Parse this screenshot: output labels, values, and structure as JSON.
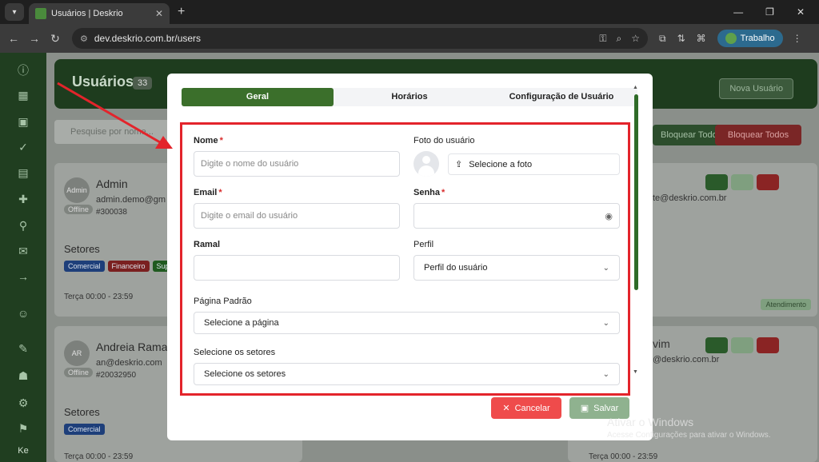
{
  "browser": {
    "tab_title": "Usuários | Deskrio",
    "url": "dev.deskrio.com.br/users",
    "profile_label": "Trabalho",
    "new_tab_glyph": "+",
    "close_tab_glyph": "✕"
  },
  "page": {
    "title": "Usuários",
    "count": "33",
    "new_user_label": "Nova Usuário",
    "search_placeholder": "Pesquise por nome...",
    "block_all_label": "Bloquear Todos",
    "unblock_all_label": "Bloquear Todos"
  },
  "sidebar": {
    "footer": "Ke"
  },
  "cards": [
    {
      "name": "Admin",
      "email": "admin.demo@gm",
      "ext": "#300038",
      "avatar": "Admin",
      "status": "Offline",
      "sectors_title": "Setores",
      "chips": [
        "Comercial",
        "Financeiro",
        "Sup"
      ],
      "schedule": "Terça 00:00 - 23:59"
    },
    {
      "name": "Andreia Rama",
      "email": "an@deskrio.com",
      "ext": "#20032950",
      "avatar": "AR",
      "status": "Offline",
      "sectors_title": "Setores",
      "chips": [
        "Comercial"
      ],
      "schedule": "Terça 00:00 - 23:59"
    }
  ],
  "right_cards": {
    "email_1": "te@deskrio.com.br",
    "email_2": "@deskrio.com.br",
    "name_2": "vim",
    "pill": "Atendimento",
    "schedule": "Terça 00:00 - 23:59"
  },
  "modal": {
    "tabs": [
      {
        "label": "Geral",
        "active": true
      },
      {
        "label": "Horários",
        "active": false
      },
      {
        "label": "Configuração de Usuário",
        "active": false
      }
    ],
    "fields": {
      "name_label": "Nome",
      "name_placeholder": "Digite o nome do usuário",
      "photo_label": "Foto do usuário",
      "photo_button": "Selecione a foto",
      "email_label": "Email",
      "email_placeholder": "Digite o email do usuário",
      "password_label": "Senha",
      "ramal_label": "Ramal",
      "perfil_label": "Perfil",
      "perfil_value": "Perfil do usuário",
      "default_page_label": "Página Padrão",
      "default_page_value": "Selecione a página",
      "sectors_label": "Selecione os setores",
      "sectors_value": "Selecione os setores",
      "required_mark": "*"
    },
    "cancel_label": "Cancelar",
    "save_label": "Salvar"
  },
  "watermark": {
    "line1": "Ativar o Windows",
    "line2": "Acesse Configurações para ativar o Windows."
  },
  "colors": {
    "accent_green": "#3b6f2b",
    "cancel_red": "#ef4b4b",
    "annotation_red": "#e3242b"
  }
}
